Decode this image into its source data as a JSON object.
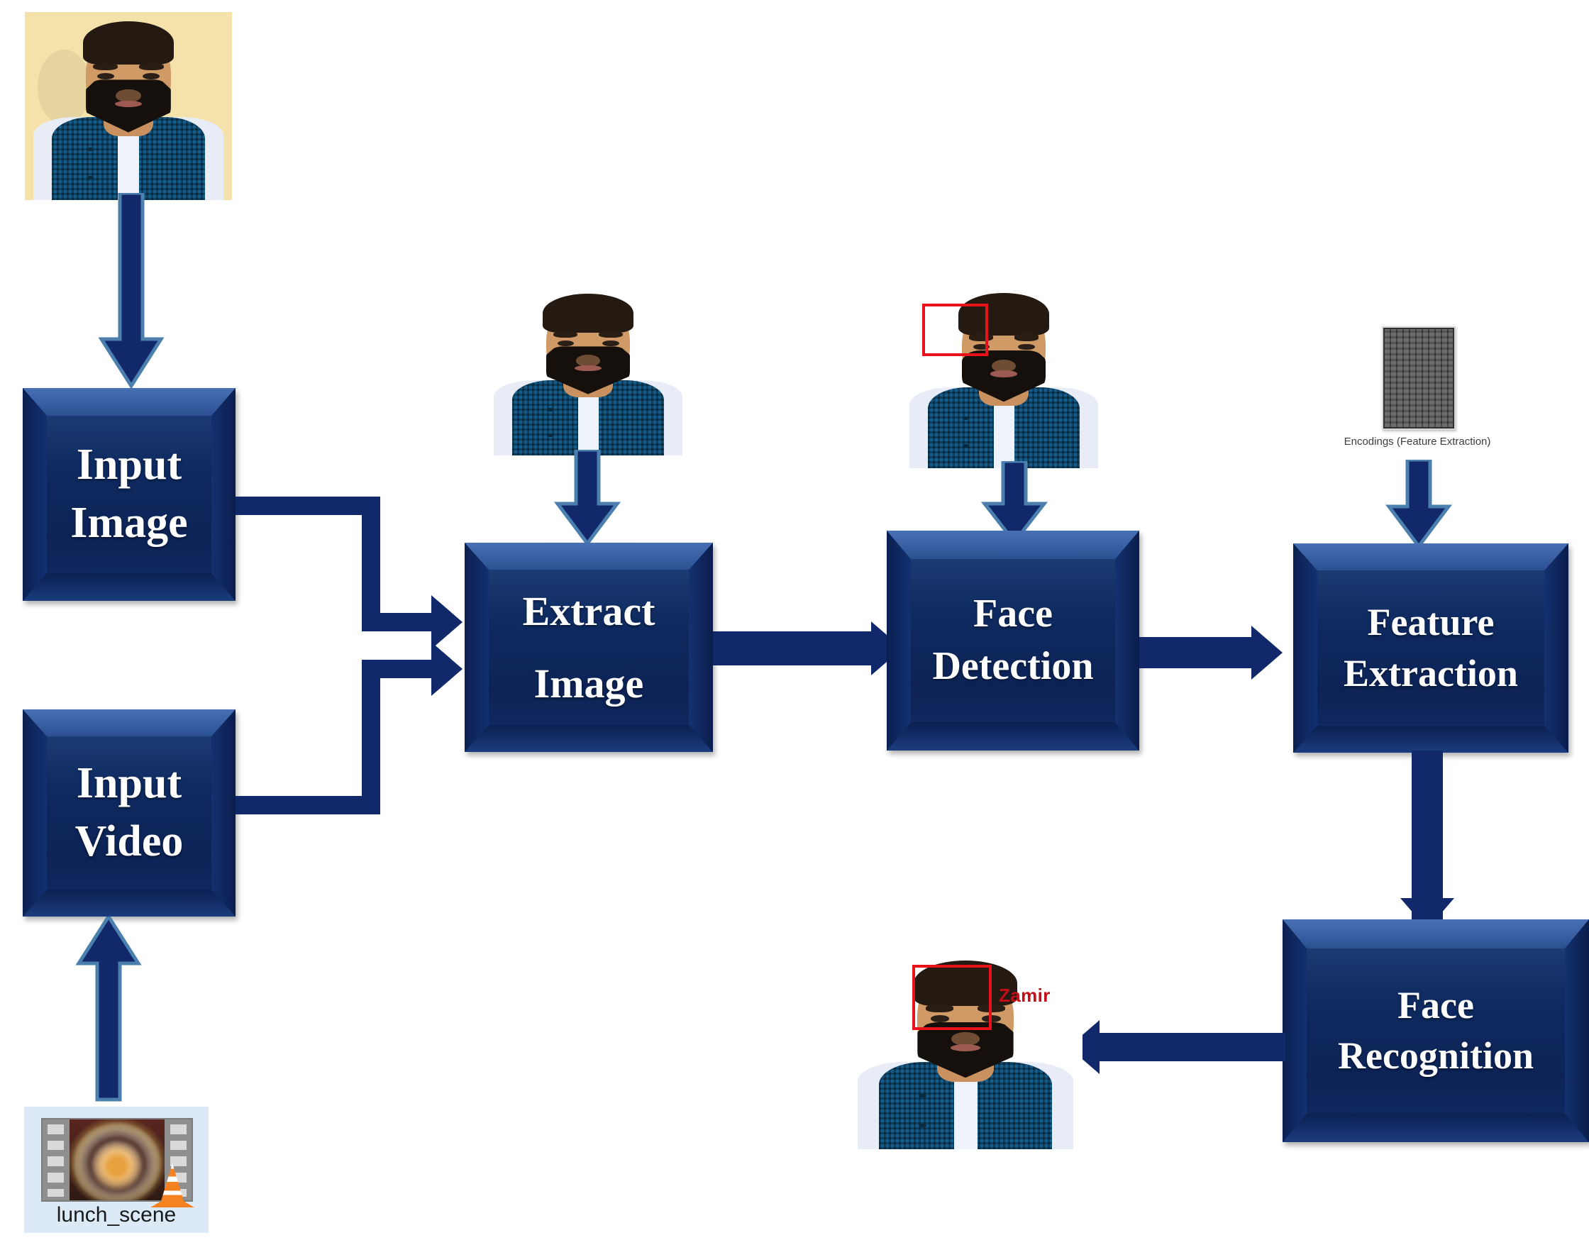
{
  "diagram": {
    "title": "Face Recognition System Flow Diagram",
    "accent_color": "#11296a",
    "box_fill_color": "#0d2356",
    "box_text_color": "#ffffff",
    "detection_box_color": "#e8131a",
    "name_label_color": "#c40d17"
  },
  "boxes": [
    {
      "id": "input-image",
      "label_line1": "Input",
      "label_line2": "Image"
    },
    {
      "id": "input-video",
      "label_line1": "Input",
      "label_line2": "Video"
    },
    {
      "id": "extract-image",
      "label_line1": "Extract",
      "label_line2": "Image"
    },
    {
      "id": "face-detection",
      "label_line1": "Face",
      "label_line2": "Detection"
    },
    {
      "id": "feature-extraction",
      "label_line1": "Feature",
      "label_line2": "Extraction"
    },
    {
      "id": "face-recognition",
      "label_line1": "Face",
      "label_line2": "Recognition"
    }
  ],
  "images": {
    "input_photo": {
      "caption": "",
      "alt": "portrait-photo-yellow-background"
    },
    "extract_photo": {
      "caption": "",
      "alt": "portrait-photo-white-background"
    },
    "detection_photo": {
      "caption": "",
      "alt": "portrait-photo-with-red-face-box"
    },
    "recognition_photo": {
      "caption": "",
      "alt": "portrait-photo-with-red-face-box-and-name",
      "name_label": "Zamir"
    }
  },
  "encodings": {
    "caption": "Encodings (Feature Extraction)",
    "alt": "dark-matrix-of-encoding-numbers"
  },
  "video_file": {
    "name": "lunch_scene",
    "alt": "video-file-thumbnail-lunch-dish",
    "player_icon": "vlc-cone-icon"
  },
  "flow": [
    {
      "from": "input_photo",
      "to": "input-image",
      "direction": "down"
    },
    {
      "from": "video_file",
      "to": "input-video",
      "direction": "up"
    },
    {
      "from": "input-image",
      "to": "extract-image",
      "direction": "right"
    },
    {
      "from": "input-video",
      "to": "extract-image",
      "direction": "right"
    },
    {
      "from": "extract_photo",
      "to": "extract-image",
      "direction": "down"
    },
    {
      "from": "extract-image",
      "to": "face-detection",
      "direction": "right"
    },
    {
      "from": "detection_photo",
      "to": "face-detection",
      "direction": "down"
    },
    {
      "from": "face-detection",
      "to": "feature-extraction",
      "direction": "right"
    },
    {
      "from": "encodings",
      "to": "feature-extraction",
      "direction": "down"
    },
    {
      "from": "feature-extraction",
      "to": "face-recognition",
      "direction": "down"
    },
    {
      "from": "face-recognition",
      "to": "recognition_photo",
      "direction": "left"
    }
  ]
}
